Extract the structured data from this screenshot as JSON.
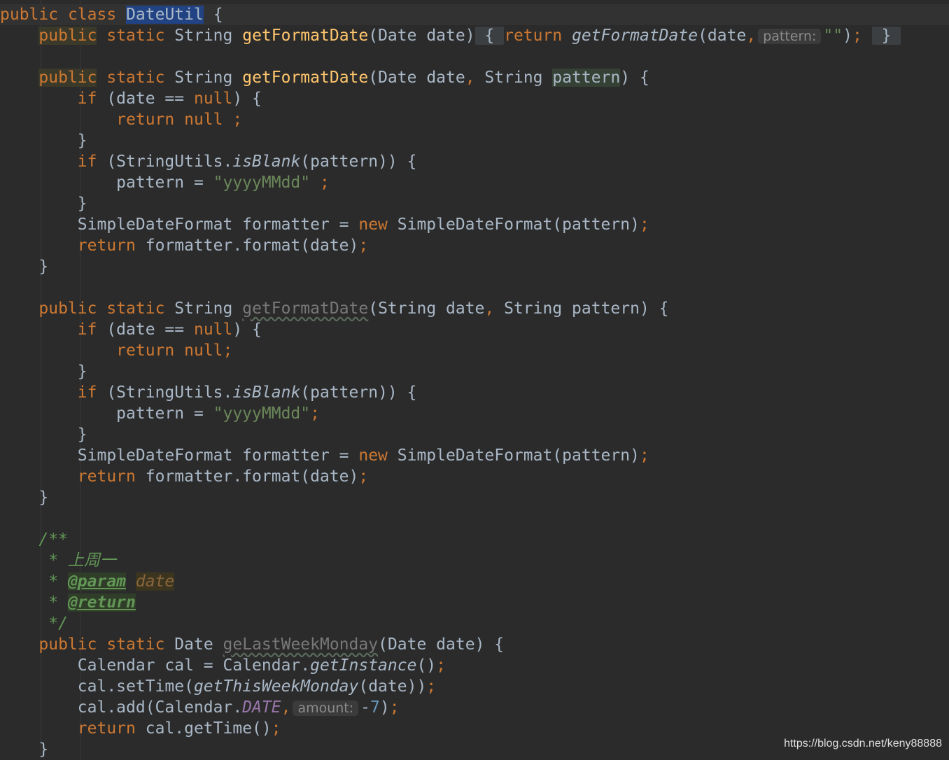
{
  "editor": {
    "lines": [
      {
        "current": true,
        "segs": [
          {
            "t": "public",
            "c": "kw"
          },
          {
            "t": " "
          },
          {
            "t": "class",
            "c": "kw"
          },
          {
            "t": " "
          },
          {
            "t": "DateUtil",
            "c": "hl-class",
            "name": "class-name"
          },
          {
            "t": " {"
          }
        ]
      },
      {
        "segs": [
          {
            "t": "    "
          },
          {
            "t": "public",
            "c": "kw hl-yellow"
          },
          {
            "t": " "
          },
          {
            "t": "static",
            "c": "kw"
          },
          {
            "t": " String "
          },
          {
            "t": "getFormatDate",
            "c": "fn"
          },
          {
            "t": "(Date date)"
          },
          {
            "t": " { ",
            "c": "fold",
            "name": "folded-brace"
          },
          {
            "t": "return",
            "c": "kw"
          },
          {
            "t": " "
          },
          {
            "t": "getFormatDate",
            "c": "it"
          },
          {
            "t": "(date"
          },
          {
            "t": ",",
            "c": "kw"
          },
          {
            "t": "pattern:",
            "c": "hint",
            "name": "param-hint-pattern"
          },
          {
            "t": "\"\"",
            "c": "str"
          },
          {
            "t": ")"
          },
          {
            "t": ";",
            "c": "kw"
          },
          {
            "t": " "
          },
          {
            "t": " } ",
            "c": "fold",
            "name": "folded-brace"
          }
        ]
      },
      {
        "segs": []
      },
      {
        "segs": [
          {
            "t": "    "
          },
          {
            "t": "public",
            "c": "kw hl-yellow"
          },
          {
            "t": " "
          },
          {
            "t": "static",
            "c": "kw"
          },
          {
            "t": " String "
          },
          {
            "t": "getFormatDate",
            "c": "fn"
          },
          {
            "t": "(Date date"
          },
          {
            "t": ",",
            "c": "kw"
          },
          {
            "t": " String "
          },
          {
            "t": "pattern",
            "c": "hl-pattern"
          },
          {
            "t": ") {"
          }
        ]
      },
      {
        "segs": [
          {
            "t": "        "
          },
          {
            "t": "if",
            "c": "kw"
          },
          {
            "t": " (date == "
          },
          {
            "t": "null",
            "c": "kw"
          },
          {
            "t": ") {"
          }
        ]
      },
      {
        "segs": [
          {
            "t": "            "
          },
          {
            "t": "return",
            "c": "kw"
          },
          {
            "t": " "
          },
          {
            "t": "null",
            "c": "kw"
          },
          {
            "t": " "
          },
          {
            "t": ";",
            "c": "kw"
          }
        ]
      },
      {
        "segs": [
          {
            "t": "        }"
          }
        ]
      },
      {
        "segs": [
          {
            "t": "        "
          },
          {
            "t": "if",
            "c": "kw"
          },
          {
            "t": " (StringUtils."
          },
          {
            "t": "isBlank",
            "c": "it"
          },
          {
            "t": "(pattern)) {"
          }
        ]
      },
      {
        "segs": [
          {
            "t": "            pattern = "
          },
          {
            "t": "\"yyyyMMdd\"",
            "c": "str"
          },
          {
            "t": " "
          },
          {
            "t": ";",
            "c": "kw"
          }
        ]
      },
      {
        "segs": [
          {
            "t": "        }"
          }
        ]
      },
      {
        "segs": [
          {
            "t": "        SimpleDateFormat formatter = "
          },
          {
            "t": "new",
            "c": "kw"
          },
          {
            "t": " SimpleDateFormat(pattern)"
          },
          {
            "t": ";",
            "c": "kw"
          }
        ]
      },
      {
        "segs": [
          {
            "t": "        "
          },
          {
            "t": "return",
            "c": "kw"
          },
          {
            "t": " formatter.format(date)"
          },
          {
            "t": ";",
            "c": "kw"
          }
        ]
      },
      {
        "segs": [
          {
            "t": "    }"
          }
        ]
      },
      {
        "segs": []
      },
      {
        "segs": [
          {
            "t": "    "
          },
          {
            "t": "public",
            "c": "kw"
          },
          {
            "t": " "
          },
          {
            "t": "static",
            "c": "kw"
          },
          {
            "t": " String "
          },
          {
            "t": "getFormatDate",
            "c": "unused"
          },
          {
            "t": "(String date"
          },
          {
            "t": ",",
            "c": "kw"
          },
          {
            "t": " String pattern) {"
          }
        ]
      },
      {
        "segs": [
          {
            "t": "        "
          },
          {
            "t": "if",
            "c": "kw"
          },
          {
            "t": " (date == "
          },
          {
            "t": "null",
            "c": "kw"
          },
          {
            "t": ") {"
          }
        ]
      },
      {
        "segs": [
          {
            "t": "            "
          },
          {
            "t": "return",
            "c": "kw"
          },
          {
            "t": " "
          },
          {
            "t": "null",
            "c": "kw"
          },
          {
            "t": ";",
            "c": "kw"
          }
        ]
      },
      {
        "segs": [
          {
            "t": "        }"
          }
        ]
      },
      {
        "segs": [
          {
            "t": "        "
          },
          {
            "t": "if",
            "c": "kw"
          },
          {
            "t": " (StringUtils."
          },
          {
            "t": "isBlank",
            "c": "it"
          },
          {
            "t": "(pattern)) {"
          }
        ]
      },
      {
        "segs": [
          {
            "t": "            pattern = "
          },
          {
            "t": "\"yyyyMMdd\"",
            "c": "str"
          },
          {
            "t": ";",
            "c": "kw"
          }
        ]
      },
      {
        "segs": [
          {
            "t": "        }"
          }
        ]
      },
      {
        "segs": [
          {
            "t": "        SimpleDateFormat formatter = "
          },
          {
            "t": "new",
            "c": "kw"
          },
          {
            "t": " SimpleDateFormat(pattern)"
          },
          {
            "t": ";",
            "c": "kw"
          }
        ]
      },
      {
        "segs": [
          {
            "t": "        "
          },
          {
            "t": "return",
            "c": "kw"
          },
          {
            "t": " formatter.format(date)"
          },
          {
            "t": ";",
            "c": "kw"
          }
        ]
      },
      {
        "segs": [
          {
            "t": "    }"
          }
        ]
      },
      {
        "segs": []
      },
      {
        "segs": [
          {
            "t": "    /**",
            "c": "cmt"
          }
        ]
      },
      {
        "segs": [
          {
            "t": "     * ",
            "c": "cmt"
          },
          {
            "t": "上周一",
            "c": "cmt"
          }
        ]
      },
      {
        "segs": [
          {
            "t": "     * ",
            "c": "cmt"
          },
          {
            "t": "@param",
            "c": "doc-tag"
          },
          {
            "t": " ",
            "c": "cmt"
          },
          {
            "t": "date",
            "c": "doc-param"
          }
        ]
      },
      {
        "segs": [
          {
            "t": "     * ",
            "c": "cmt"
          },
          {
            "t": "@return",
            "c": "doc-tag"
          }
        ]
      },
      {
        "segs": [
          {
            "t": "     */",
            "c": "cmt"
          }
        ]
      },
      {
        "segs": [
          {
            "t": "    "
          },
          {
            "t": "public",
            "c": "kw"
          },
          {
            "t": " "
          },
          {
            "t": "static",
            "c": "kw"
          },
          {
            "t": " Date "
          },
          {
            "t": "geLastWeekMonday",
            "c": "unused"
          },
          {
            "t": "(Date date) {"
          }
        ]
      },
      {
        "segs": [
          {
            "t": "        Calendar cal = Calendar."
          },
          {
            "t": "getInstance",
            "c": "it"
          },
          {
            "t": "()"
          },
          {
            "t": ";",
            "c": "kw"
          }
        ]
      },
      {
        "segs": [
          {
            "t": "        cal.setTime("
          },
          {
            "t": "getThisWeekMonday",
            "c": "it"
          },
          {
            "t": "(date))"
          },
          {
            "t": ";",
            "c": "kw"
          }
        ]
      },
      {
        "segs": [
          {
            "t": "        cal.add(Calendar."
          },
          {
            "t": "DATE",
            "c": "static-fld"
          },
          {
            "t": ",",
            "c": "kw"
          },
          {
            "t": "amount:",
            "c": "hint",
            "name": "param-hint-amount"
          },
          {
            "t": "-"
          },
          {
            "t": "7",
            "c": "num"
          },
          {
            "t": ")"
          },
          {
            "t": ";",
            "c": "kw"
          }
        ]
      },
      {
        "segs": [
          {
            "t": "        "
          },
          {
            "t": "return",
            "c": "kw"
          },
          {
            "t": " cal.getTime()"
          },
          {
            "t": ";",
            "c": "kw"
          }
        ]
      },
      {
        "segs": [
          {
            "t": "    }"
          }
        ]
      }
    ]
  },
  "watermark": "https://blog.csdn.net/keny88888"
}
